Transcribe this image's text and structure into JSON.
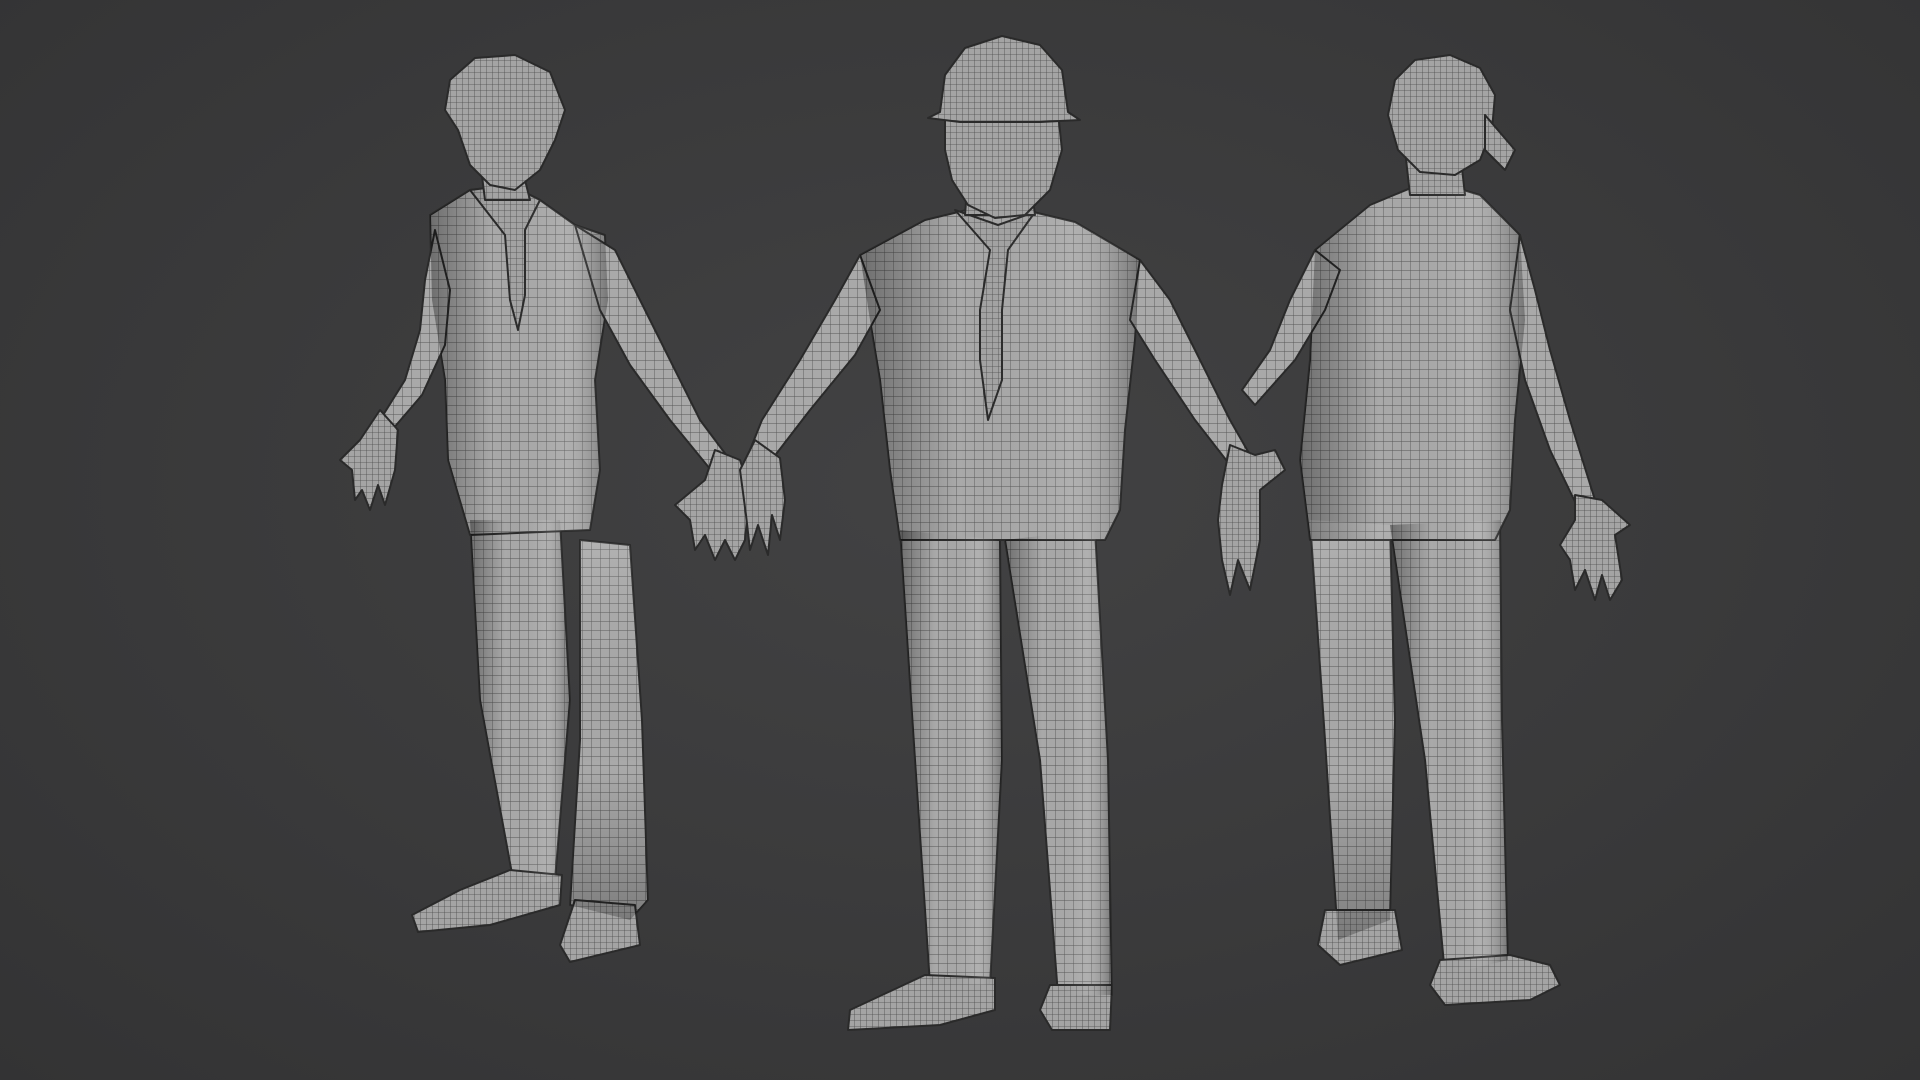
{
  "scene": {
    "background_color": "#3b3b3c",
    "mesh_fill_color": "#a9a9a9",
    "wire_color": "#2f2f2f",
    "models": [
      {
        "view": "three-quarter-front",
        "headwear": "none",
        "material": "clay-wireframe"
      },
      {
        "view": "front",
        "headwear": "hard-hat",
        "material": "clay-wireframe"
      },
      {
        "view": "back-three-quarter",
        "headwear": "cap",
        "material": "clay-wireframe"
      }
    ]
  }
}
